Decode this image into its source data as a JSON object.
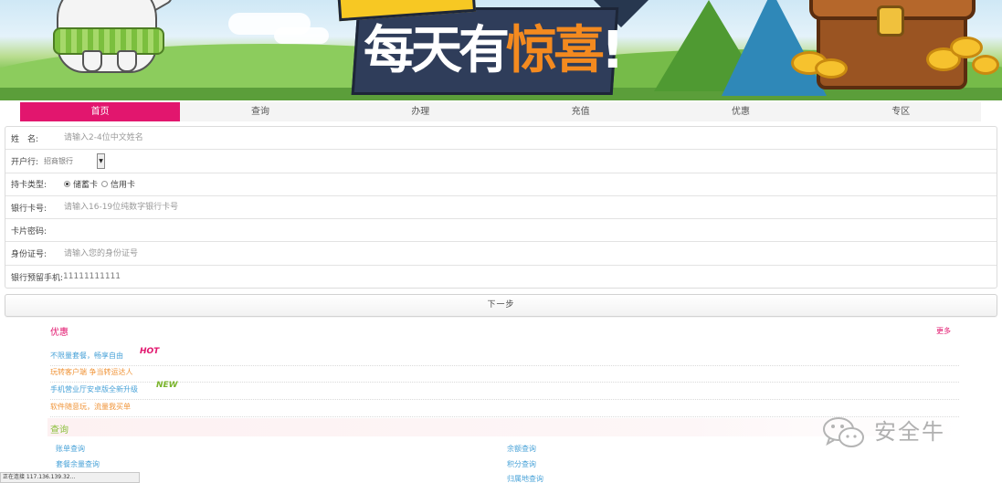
{
  "banner": {
    "slogan_a": "每天有",
    "slogan_b": "惊喜",
    "slogan_c": "!",
    "colors": {
      "sign": "#2f3d5a",
      "highlight": "#f48a1f",
      "grass": "#7cc24e"
    }
  },
  "nav": {
    "tabs": [
      {
        "label": "首页",
        "active": true
      },
      {
        "label": "查询",
        "active": false
      },
      {
        "label": "办理",
        "active": false
      },
      {
        "label": "充值",
        "active": false
      },
      {
        "label": "优惠",
        "active": false
      },
      {
        "label": "专区",
        "active": false
      }
    ],
    "accent": "#e2166e"
  },
  "form": {
    "name": {
      "label": "姓　名:",
      "placeholder": "请输入2-4位中文姓名",
      "value": ""
    },
    "bank": {
      "label": "开户行:",
      "selected": "招商银行"
    },
    "card_type": {
      "label": "持卡类型:",
      "options": [
        "储蓄卡",
        "信用卡"
      ],
      "selected": "储蓄卡"
    },
    "card_no": {
      "label": "银行卡号:",
      "placeholder": "请输入16-19位纯数字银行卡号",
      "value": ""
    },
    "card_pwd": {
      "label": "卡片密码:",
      "placeholder": "",
      "value": ""
    },
    "id_no": {
      "label": "身份证号:",
      "placeholder": "请输入您的身份证号",
      "value": ""
    },
    "phone": {
      "label": "银行预留手机:",
      "value": "11111111111"
    }
  },
  "next_button": {
    "label": "下一步"
  },
  "promotions": {
    "title": "优惠",
    "more": "更多",
    "items": [
      {
        "text": "不限量套餐，畅享自由",
        "color": "#4aa3d8",
        "badge": "HOT"
      },
      {
        "text": "玩转客户端 争当转运达人",
        "color": "#f0953a",
        "badge": ""
      },
      {
        "text": "手机营业厅安卓版全新升级",
        "color": "#4aa3d8",
        "badge": "NEW"
      },
      {
        "text": "软件随意玩，流量我买单",
        "color": "#f0953a",
        "badge": ""
      }
    ]
  },
  "query": {
    "title": "查询",
    "left": [
      "账单查询",
      "套餐余量查询"
    ],
    "right": [
      "余额查询",
      "积分查询",
      "归属地查询"
    ]
  },
  "watermark": {
    "text": "安全牛"
  },
  "status_bar": {
    "text": "正在连接 117.136.139.32..."
  }
}
